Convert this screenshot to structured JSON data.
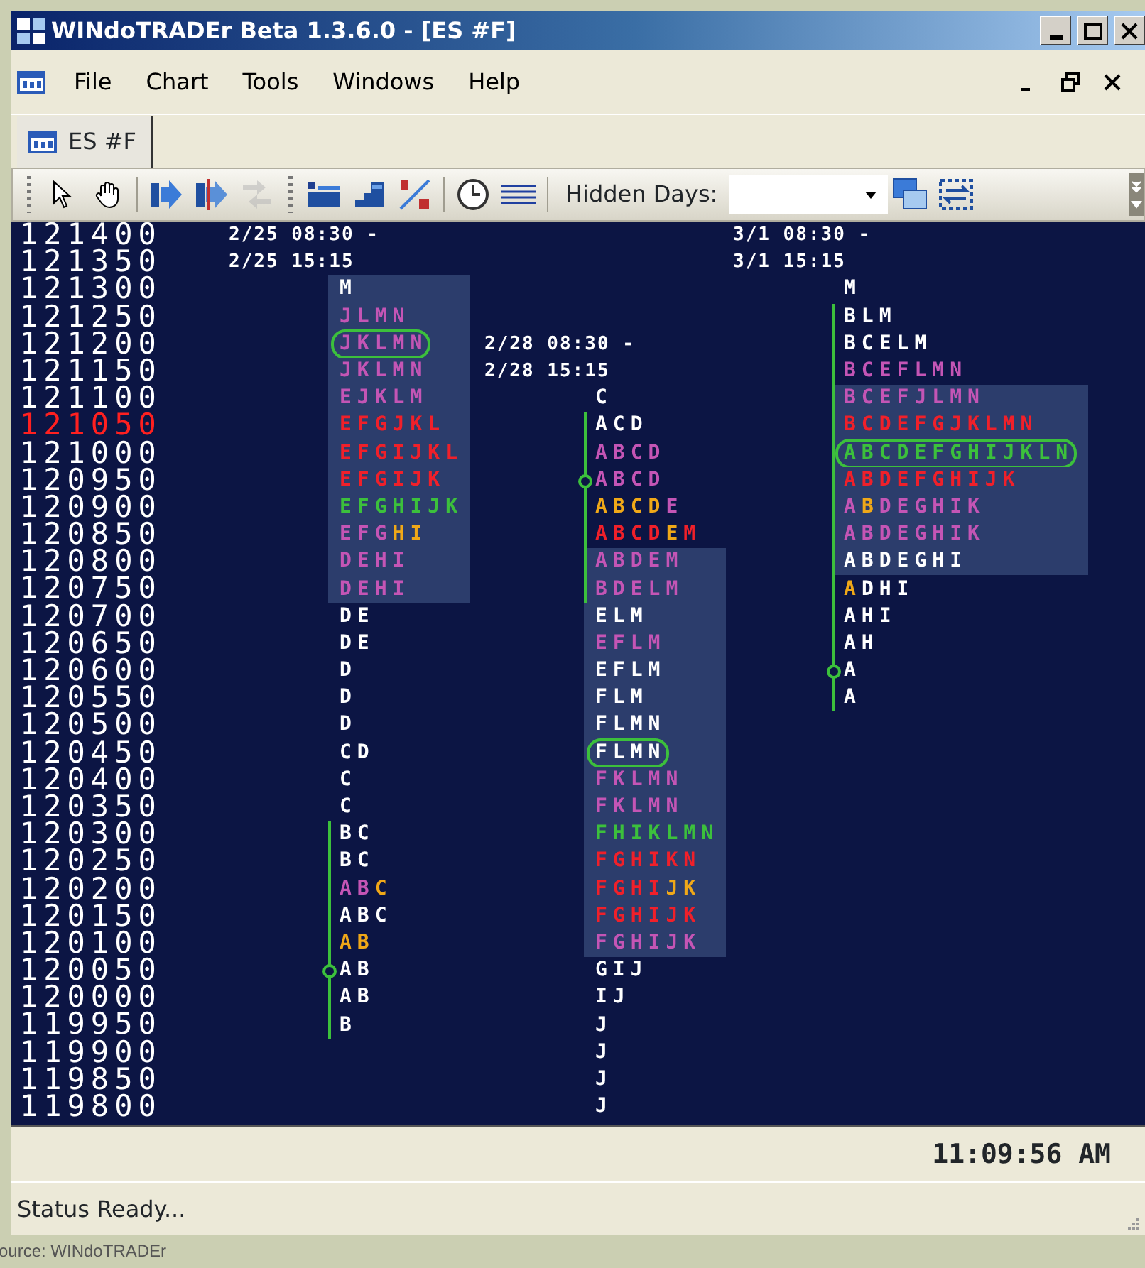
{
  "window": {
    "title": "WINdoTRADEr Beta 1.3.6.0 - [ES #F]"
  },
  "menu": [
    "File",
    "Chart",
    "Tools",
    "Windows",
    "Help"
  ],
  "tabs": [
    {
      "label": "ES #F",
      "selected": true
    }
  ],
  "toolbar": [
    {
      "kind": "grip"
    },
    {
      "kind": "pointer",
      "disabled": false
    },
    {
      "kind": "hand",
      "disabled": false
    },
    {
      "kind": "separator"
    },
    {
      "kind": "bar-arrow",
      "disabled": false
    },
    {
      "kind": "bar-arrow-split",
      "disabled": false
    },
    {
      "kind": "swap",
      "disabled": true
    },
    {
      "kind": "grip"
    },
    {
      "kind": "profile",
      "disabled": false
    },
    {
      "kind": "steps",
      "disabled": false
    },
    {
      "kind": "slash",
      "disabled": false
    },
    {
      "kind": "separator"
    },
    {
      "kind": "clock",
      "disabled": false
    },
    {
      "kind": "lines",
      "disabled": false
    },
    {
      "kind": "separator"
    },
    {
      "kind": "label",
      "text": "Hidden Days:"
    },
    {
      "kind": "dropdown"
    },
    {
      "kind": "cascade",
      "disabled": false
    },
    {
      "kind": "fit",
      "disabled": false
    },
    {
      "kind": "overflow"
    }
  ],
  "ladder": [
    {
      "price": "121400",
      "current": false,
      "columns": [
        {
          "kind": "session",
          "text": "2/25 08:30 -"
        },
        {
          "kind": "empty"
        },
        {
          "kind": "session",
          "text": "3/1 08:30 -"
        }
      ]
    },
    {
      "price": "121350",
      "current": false,
      "columns": [
        {
          "kind": "session",
          "text": "2/25 15:15"
        },
        {
          "kind": "empty"
        },
        {
          "kind": "session",
          "text": "3/1 15:15"
        }
      ]
    },
    {
      "price": "121300",
      "current": false,
      "columns": [
        {
          "kind": "tpo",
          "segments": [
            {
              "text": "M",
              "color": "#ffffff"
            }
          ],
          "value_area": true,
          "circled": false,
          "initial_balance": false,
          "marker": false
        },
        {
          "kind": "empty"
        },
        {
          "kind": "tpo",
          "segments": [
            {
              "text": "M",
              "color": "#ffffff"
            }
          ],
          "value_area": false,
          "circled": false,
          "initial_balance": false,
          "marker": false
        }
      ]
    },
    {
      "price": "121250",
      "current": false,
      "columns": [
        {
          "kind": "tpo",
          "segments": [
            {
              "text": "JLMN",
              "color": "#c455b5"
            }
          ],
          "value_area": true,
          "circled": false,
          "initial_balance": false,
          "marker": false
        },
        {
          "kind": "empty"
        },
        {
          "kind": "tpo",
          "segments": [
            {
              "text": "BLM",
              "color": "#ffffff"
            }
          ],
          "value_area": false,
          "circled": false,
          "initial_balance": true,
          "marker": false
        }
      ]
    },
    {
      "price": "121200",
      "current": false,
      "columns": [
        {
          "kind": "tpo",
          "segments": [
            {
              "text": "JKLMN",
              "color": "#c455b5"
            }
          ],
          "value_area": true,
          "circled": true,
          "initial_balance": false,
          "marker": false
        },
        {
          "kind": "session",
          "text": "2/28 08:30 -"
        },
        {
          "kind": "tpo",
          "segments": [
            {
              "text": "BCELM",
              "color": "#ffffff"
            }
          ],
          "value_area": false,
          "circled": false,
          "initial_balance": true,
          "marker": false
        }
      ]
    },
    {
      "price": "121150",
      "current": false,
      "columns": [
        {
          "kind": "tpo",
          "segments": [
            {
              "text": "JKLMN",
              "color": "#c455b5"
            }
          ],
          "value_area": true,
          "circled": false,
          "initial_balance": false,
          "marker": false
        },
        {
          "kind": "session",
          "text": "2/28 15:15"
        },
        {
          "kind": "tpo",
          "segments": [
            {
              "text": "BCEFLMN",
              "color": "#c455b5"
            }
          ],
          "value_area": false,
          "circled": false,
          "initial_balance": true,
          "marker": false
        }
      ]
    },
    {
      "price": "121100",
      "current": false,
      "columns": [
        {
          "kind": "tpo",
          "segments": [
            {
              "text": "EJKLM",
              "color": "#c455b5"
            }
          ],
          "value_area": true,
          "circled": false,
          "initial_balance": false,
          "marker": false
        },
        {
          "kind": "tpo",
          "segments": [
            {
              "text": "C",
              "color": "#ffffff"
            }
          ],
          "value_area": false,
          "circled": false,
          "initial_balance": false,
          "marker": false
        },
        {
          "kind": "tpo",
          "segments": [
            {
              "text": "BCEFJLMN",
              "color": "#c455b5"
            }
          ],
          "value_area": true,
          "circled": false,
          "initial_balance": true,
          "marker": false
        }
      ]
    },
    {
      "price": "121050",
      "current": true,
      "columns": [
        {
          "kind": "tpo",
          "segments": [
            {
              "text": "EFGJKL",
              "color": "#f0202a"
            }
          ],
          "value_area": true,
          "circled": false,
          "initial_balance": false,
          "marker": false
        },
        {
          "kind": "tpo",
          "segments": [
            {
              "text": "ACD",
              "color": "#ffffff"
            }
          ],
          "value_area": false,
          "circled": false,
          "initial_balance": true,
          "marker": false
        },
        {
          "kind": "tpo",
          "segments": [
            {
              "text": "BCDEFGJKLMN",
              "color": "#f0202a"
            }
          ],
          "value_area": true,
          "circled": false,
          "initial_balance": true,
          "marker": false
        }
      ]
    },
    {
      "price": "121000",
      "current": false,
      "columns": [
        {
          "kind": "tpo",
          "segments": [
            {
              "text": "EFGIJKL",
              "color": "#f0202a"
            }
          ],
          "value_area": true,
          "circled": false,
          "initial_balance": false,
          "marker": false
        },
        {
          "kind": "tpo",
          "segments": [
            {
              "text": "ABCD",
              "color": "#c455b5"
            }
          ],
          "value_area": false,
          "circled": false,
          "initial_balance": true,
          "marker": false
        },
        {
          "kind": "tpo",
          "segments": [
            {
              "text": "ABCDEFGHIJKLN",
              "color": "#3cc03c"
            }
          ],
          "value_area": true,
          "circled": true,
          "initial_balance": true,
          "marker": false
        }
      ]
    },
    {
      "price": "120950",
      "current": false,
      "columns": [
        {
          "kind": "tpo",
          "segments": [
            {
              "text": "EFGIJK",
              "color": "#f0202a"
            }
          ],
          "value_area": true,
          "circled": false,
          "initial_balance": false,
          "marker": false
        },
        {
          "kind": "tpo",
          "segments": [
            {
              "text": "ABCD",
              "color": "#c455b5"
            }
          ],
          "value_area": false,
          "circled": false,
          "initial_balance": true,
          "marker": true
        },
        {
          "kind": "tpo",
          "segments": [
            {
              "text": "ABDEFGHIJK",
              "color": "#f0202a"
            }
          ],
          "value_area": true,
          "circled": false,
          "initial_balance": true,
          "marker": false
        }
      ]
    },
    {
      "price": "120900",
      "current": false,
      "columns": [
        {
          "kind": "tpo",
          "segments": [
            {
              "text": "EFGHIJK",
              "color": "#3cc03c"
            }
          ],
          "value_area": true,
          "circled": false,
          "initial_balance": false,
          "marker": false
        },
        {
          "kind": "tpo",
          "segments": [
            {
              "text": "ABCD",
              "color": "#f0a818"
            },
            {
              "text": "E",
              "color": "#c455b5"
            }
          ],
          "value_area": false,
          "circled": false,
          "initial_balance": true,
          "marker": false
        },
        {
          "kind": "tpo",
          "segments": [
            {
              "text": "A",
              "color": "#c455b5"
            },
            {
              "text": "B",
              "color": "#f0a818"
            },
            {
              "text": "DEGHIK",
              "color": "#c455b5"
            }
          ],
          "value_area": true,
          "circled": false,
          "initial_balance": true,
          "marker": false
        }
      ]
    },
    {
      "price": "120850",
      "current": false,
      "columns": [
        {
          "kind": "tpo",
          "segments": [
            {
              "text": "EFG",
              "color": "#c455b5"
            },
            {
              "text": "HI",
              "color": "#f0a818"
            }
          ],
          "value_area": true,
          "circled": false,
          "initial_balance": false,
          "marker": false
        },
        {
          "kind": "tpo",
          "segments": [
            {
              "text": "ABCD",
              "color": "#f0202a"
            },
            {
              "text": "E",
              "color": "#f0a818"
            },
            {
              "text": "M",
              "color": "#f0202a"
            }
          ],
          "value_area": false,
          "circled": false,
          "initial_balance": true,
          "marker": false
        },
        {
          "kind": "tpo",
          "segments": [
            {
              "text": "ABDEGHIK",
              "color": "#c455b5"
            }
          ],
          "value_area": true,
          "circled": false,
          "initial_balance": true,
          "marker": false
        }
      ]
    },
    {
      "price": "120800",
      "current": false,
      "columns": [
        {
          "kind": "tpo",
          "segments": [
            {
              "text": "DEHI",
              "color": "#c455b5"
            }
          ],
          "value_area": true,
          "circled": false,
          "initial_balance": false,
          "marker": false
        },
        {
          "kind": "tpo",
          "segments": [
            {
              "text": "ABDEM",
              "color": "#c455b5"
            }
          ],
          "value_area": true,
          "circled": false,
          "initial_balance": true,
          "marker": false
        },
        {
          "kind": "tpo",
          "segments": [
            {
              "text": "ABDEGHI",
              "color": "#ffffff"
            }
          ],
          "value_area": true,
          "circled": false,
          "initial_balance": true,
          "marker": false
        }
      ]
    },
    {
      "price": "120750",
      "current": false,
      "columns": [
        {
          "kind": "tpo",
          "segments": [
            {
              "text": "DEHI",
              "color": "#c455b5"
            }
          ],
          "value_area": true,
          "circled": false,
          "initial_balance": false,
          "marker": false
        },
        {
          "kind": "tpo",
          "segments": [
            {
              "text": "BDELM",
              "color": "#c455b5"
            }
          ],
          "value_area": true,
          "circled": false,
          "initial_balance": true,
          "marker": false
        },
        {
          "kind": "tpo",
          "segments": [
            {
              "text": "A",
              "color": "#f0a818"
            },
            {
              "text": "DHI",
              "color": "#ffffff"
            }
          ],
          "value_area": false,
          "circled": false,
          "initial_balance": true,
          "marker": false
        }
      ]
    },
    {
      "price": "120700",
      "current": false,
      "columns": [
        {
          "kind": "tpo",
          "segments": [
            {
              "text": "DE",
              "color": "#ffffff"
            }
          ],
          "value_area": false,
          "circled": false,
          "initial_balance": false,
          "marker": false
        },
        {
          "kind": "tpo",
          "segments": [
            {
              "text": "ELM",
              "color": "#ffffff"
            }
          ],
          "value_area": true,
          "circled": false,
          "initial_balance": false,
          "marker": false
        },
        {
          "kind": "tpo",
          "segments": [
            {
              "text": "AHI",
              "color": "#ffffff"
            }
          ],
          "value_area": false,
          "circled": false,
          "initial_balance": true,
          "marker": false
        }
      ]
    },
    {
      "price": "120650",
      "current": false,
      "columns": [
        {
          "kind": "tpo",
          "segments": [
            {
              "text": "DE",
              "color": "#ffffff"
            }
          ],
          "value_area": false,
          "circled": false,
          "initial_balance": false,
          "marker": false
        },
        {
          "kind": "tpo",
          "segments": [
            {
              "text": "EFLM",
              "color": "#c455b5"
            }
          ],
          "value_area": true,
          "circled": false,
          "initial_balance": false,
          "marker": false
        },
        {
          "kind": "tpo",
          "segments": [
            {
              "text": "AH",
              "color": "#ffffff"
            }
          ],
          "value_area": false,
          "circled": false,
          "initial_balance": true,
          "marker": false
        }
      ]
    },
    {
      "price": "120600",
      "current": false,
      "columns": [
        {
          "kind": "tpo",
          "segments": [
            {
              "text": "D",
              "color": "#ffffff"
            }
          ],
          "value_area": false,
          "circled": false,
          "initial_balance": false,
          "marker": false
        },
        {
          "kind": "tpo",
          "segments": [
            {
              "text": "EFLM",
              "color": "#ffffff"
            }
          ],
          "value_area": true,
          "circled": false,
          "initial_balance": false,
          "marker": false
        },
        {
          "kind": "tpo",
          "segments": [
            {
              "text": "A",
              "color": "#ffffff"
            }
          ],
          "value_area": false,
          "circled": false,
          "initial_balance": true,
          "marker": true
        }
      ]
    },
    {
      "price": "120550",
      "current": false,
      "columns": [
        {
          "kind": "tpo",
          "segments": [
            {
              "text": "D",
              "color": "#ffffff"
            }
          ],
          "value_area": false,
          "circled": false,
          "initial_balance": false,
          "marker": false
        },
        {
          "kind": "tpo",
          "segments": [
            {
              "text": "FLM",
              "color": "#ffffff"
            }
          ],
          "value_area": true,
          "circled": false,
          "initial_balance": false,
          "marker": false
        },
        {
          "kind": "tpo",
          "segments": [
            {
              "text": "A",
              "color": "#ffffff"
            }
          ],
          "value_area": false,
          "circled": false,
          "initial_balance": true,
          "marker": false
        }
      ]
    },
    {
      "price": "120500",
      "current": false,
      "columns": [
        {
          "kind": "tpo",
          "segments": [
            {
              "text": "D",
              "color": "#ffffff"
            }
          ],
          "value_area": false,
          "circled": false,
          "initial_balance": false,
          "marker": false
        },
        {
          "kind": "tpo",
          "segments": [
            {
              "text": "FLMN",
              "color": "#ffffff"
            }
          ],
          "value_area": true,
          "circled": false,
          "initial_balance": false,
          "marker": false
        },
        {
          "kind": "empty"
        }
      ]
    },
    {
      "price": "120450",
      "current": false,
      "columns": [
        {
          "kind": "tpo",
          "segments": [
            {
              "text": "CD",
              "color": "#ffffff"
            }
          ],
          "value_area": false,
          "circled": false,
          "initial_balance": false,
          "marker": false
        },
        {
          "kind": "tpo",
          "segments": [
            {
              "text": "FLMN",
              "color": "#ffffff"
            }
          ],
          "value_area": true,
          "circled": true,
          "initial_balance": false,
          "marker": false
        },
        {
          "kind": "empty"
        }
      ]
    },
    {
      "price": "120400",
      "current": false,
      "columns": [
        {
          "kind": "tpo",
          "segments": [
            {
              "text": "C",
              "color": "#ffffff"
            }
          ],
          "value_area": false,
          "circled": false,
          "initial_balance": false,
          "marker": false
        },
        {
          "kind": "tpo",
          "segments": [
            {
              "text": "FKLMN",
              "color": "#c455b5"
            }
          ],
          "value_area": true,
          "circled": false,
          "initial_balance": false,
          "marker": false
        },
        {
          "kind": "empty"
        }
      ]
    },
    {
      "price": "120350",
      "current": false,
      "columns": [
        {
          "kind": "tpo",
          "segments": [
            {
              "text": "C",
              "color": "#ffffff"
            }
          ],
          "value_area": false,
          "circled": false,
          "initial_balance": false,
          "marker": false
        },
        {
          "kind": "tpo",
          "segments": [
            {
              "text": "FKLMN",
              "color": "#c455b5"
            }
          ],
          "value_area": true,
          "circled": false,
          "initial_balance": false,
          "marker": false
        },
        {
          "kind": "empty"
        }
      ]
    },
    {
      "price": "120300",
      "current": false,
      "columns": [
        {
          "kind": "tpo",
          "segments": [
            {
              "text": "BC",
              "color": "#ffffff"
            }
          ],
          "value_area": false,
          "circled": false,
          "initial_balance": true,
          "marker": false
        },
        {
          "kind": "tpo",
          "segments": [
            {
              "text": "FHIKLMN",
              "color": "#3cc03c"
            }
          ],
          "value_area": true,
          "circled": false,
          "initial_balance": false,
          "marker": false
        },
        {
          "kind": "empty"
        }
      ]
    },
    {
      "price": "120250",
      "current": false,
      "columns": [
        {
          "kind": "tpo",
          "segments": [
            {
              "text": "BC",
              "color": "#ffffff"
            }
          ],
          "value_area": false,
          "circled": false,
          "initial_balance": true,
          "marker": false
        },
        {
          "kind": "tpo",
          "segments": [
            {
              "text": "FGHIKN",
              "color": "#f0202a"
            }
          ],
          "value_area": true,
          "circled": false,
          "initial_balance": false,
          "marker": false
        },
        {
          "kind": "empty"
        }
      ]
    },
    {
      "price": "120200",
      "current": false,
      "columns": [
        {
          "kind": "tpo",
          "segments": [
            {
              "text": "AB",
              "color": "#c455b5"
            },
            {
              "text": "C",
              "color": "#f0a818"
            }
          ],
          "value_area": false,
          "circled": false,
          "initial_balance": true,
          "marker": false
        },
        {
          "kind": "tpo",
          "segments": [
            {
              "text": "FGHI",
              "color": "#f0202a"
            },
            {
              "text": "JK",
              "color": "#f0a818"
            }
          ],
          "value_area": true,
          "circled": false,
          "initial_balance": false,
          "marker": false
        },
        {
          "kind": "empty"
        }
      ]
    },
    {
      "price": "120150",
      "current": false,
      "columns": [
        {
          "kind": "tpo",
          "segments": [
            {
              "text": "ABC",
              "color": "#ffffff"
            }
          ],
          "value_area": false,
          "circled": false,
          "initial_balance": true,
          "marker": false
        },
        {
          "kind": "tpo",
          "segments": [
            {
              "text": "FGHIJK",
              "color": "#f0202a"
            }
          ],
          "value_area": true,
          "circled": false,
          "initial_balance": false,
          "marker": false
        },
        {
          "kind": "empty"
        }
      ]
    },
    {
      "price": "120100",
      "current": false,
      "columns": [
        {
          "kind": "tpo",
          "segments": [
            {
              "text": "AB",
              "color": "#f0a818"
            }
          ],
          "value_area": false,
          "circled": false,
          "initial_balance": true,
          "marker": false
        },
        {
          "kind": "tpo",
          "segments": [
            {
              "text": "FGHIJK",
              "color": "#c455b5"
            }
          ],
          "value_area": true,
          "circled": false,
          "initial_balance": false,
          "marker": false
        },
        {
          "kind": "empty"
        }
      ]
    },
    {
      "price": "120050",
      "current": false,
      "columns": [
        {
          "kind": "tpo",
          "segments": [
            {
              "text": "AB",
              "color": "#ffffff"
            }
          ],
          "value_area": false,
          "circled": false,
          "initial_balance": true,
          "marker": true
        },
        {
          "kind": "tpo",
          "segments": [
            {
              "text": "GIJ",
              "color": "#ffffff"
            }
          ],
          "value_area": false,
          "circled": false,
          "initial_balance": false,
          "marker": false
        },
        {
          "kind": "empty"
        }
      ]
    },
    {
      "price": "120000",
      "current": false,
      "columns": [
        {
          "kind": "tpo",
          "segments": [
            {
              "text": "AB",
              "color": "#ffffff"
            }
          ],
          "value_area": false,
          "circled": false,
          "initial_balance": true,
          "marker": false
        },
        {
          "kind": "tpo",
          "segments": [
            {
              "text": "IJ",
              "color": "#ffffff"
            }
          ],
          "value_area": false,
          "circled": false,
          "initial_balance": false,
          "marker": false
        },
        {
          "kind": "empty"
        }
      ]
    },
    {
      "price": "119950",
      "current": false,
      "columns": [
        {
          "kind": "tpo",
          "segments": [
            {
              "text": "B",
              "color": "#ffffff"
            }
          ],
          "value_area": false,
          "circled": false,
          "initial_balance": true,
          "marker": false
        },
        {
          "kind": "tpo",
          "segments": [
            {
              "text": "J",
              "color": "#ffffff"
            }
          ],
          "value_area": false,
          "circled": false,
          "initial_balance": false,
          "marker": false
        },
        {
          "kind": "empty"
        }
      ]
    },
    {
      "price": "119900",
      "current": false,
      "columns": [
        {
          "kind": "empty"
        },
        {
          "kind": "tpo",
          "segments": [
            {
              "text": "J",
              "color": "#ffffff"
            }
          ],
          "value_area": false,
          "circled": false,
          "initial_balance": false,
          "marker": false
        },
        {
          "kind": "empty"
        }
      ]
    },
    {
      "price": "119850",
      "current": false,
      "columns": [
        {
          "kind": "empty"
        },
        {
          "kind": "tpo",
          "segments": [
            {
              "text": "J",
              "color": "#ffffff"
            }
          ],
          "value_area": false,
          "circled": false,
          "initial_balance": false,
          "marker": false
        },
        {
          "kind": "empty"
        }
      ]
    },
    {
      "price": "119800",
      "current": false,
      "columns": [
        {
          "kind": "empty"
        },
        {
          "kind": "tpo",
          "segments": [
            {
              "text": "J",
              "color": "#ffffff"
            }
          ],
          "value_area": false,
          "circled": false,
          "initial_balance": false,
          "marker": false
        },
        {
          "kind": "empty"
        }
      ]
    }
  ],
  "clock": "11:09:56 AM",
  "status_bar": "Status Ready...",
  "caption": "ource: WINdoTRADEr"
}
